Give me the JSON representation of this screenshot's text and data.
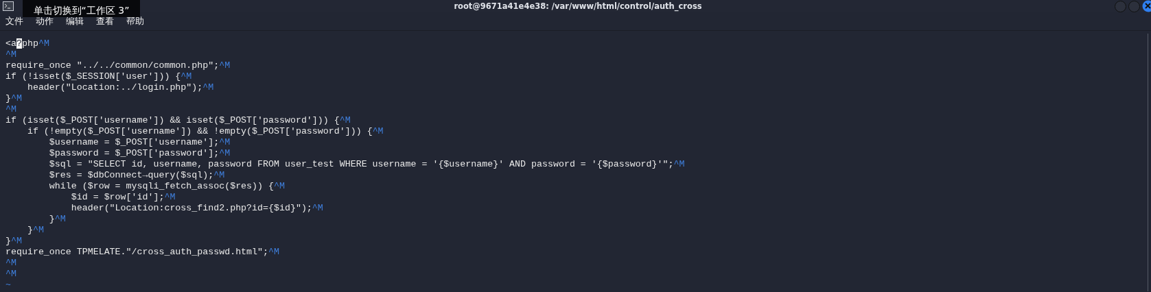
{
  "window": {
    "title": "root@9671a41e4e38: /var/www/html/control/auth_cross"
  },
  "menu": [
    {
      "label": "文件"
    },
    {
      "label": "动作"
    },
    {
      "label": "编辑"
    },
    {
      "label": "查看"
    },
    {
      "label": "帮助"
    }
  ],
  "tooltip": "单击切换到“工作区 3”",
  "editor": {
    "lines": [
      [
        {
          "kind": "code",
          "text": "<a"
        },
        {
          "kind": "cursor",
          "text": "?"
        },
        {
          "kind": "code",
          "text": "php"
        },
        {
          "kind": "ctrl",
          "text": "^M"
        }
      ],
      [
        {
          "kind": "ctrl",
          "text": "^M"
        }
      ],
      [
        {
          "kind": "code",
          "text": "require_once \"../../common/common.php\";"
        },
        {
          "kind": "ctrl",
          "text": "^M"
        }
      ],
      [
        {
          "kind": "code",
          "text": "if (!isset($_SESSION['user'])) {"
        },
        {
          "kind": "ctrl",
          "text": "^M"
        }
      ],
      [
        {
          "kind": "code",
          "text": "    header(\"Location:../login.php\");"
        },
        {
          "kind": "ctrl",
          "text": "^M"
        }
      ],
      [
        {
          "kind": "code",
          "text": "}"
        },
        {
          "kind": "ctrl",
          "text": "^M"
        }
      ],
      [
        {
          "kind": "ctrl",
          "text": "^M"
        }
      ],
      [
        {
          "kind": "code",
          "text": "if (isset($_POST['username']) && isset($_POST['password'])) {"
        },
        {
          "kind": "ctrl",
          "text": "^M"
        }
      ],
      [
        {
          "kind": "code",
          "text": "    if (!empty($_POST['username']) && !empty($_POST['password'])) {"
        },
        {
          "kind": "ctrl",
          "text": "^M"
        }
      ],
      [
        {
          "kind": "code",
          "text": "        $username = $_POST['username'];"
        },
        {
          "kind": "ctrl",
          "text": "^M"
        }
      ],
      [
        {
          "kind": "code",
          "text": "        $password = $_POST['password'];"
        },
        {
          "kind": "ctrl",
          "text": "^M"
        }
      ],
      [
        {
          "kind": "code",
          "text": "        $sql = \"SELECT id, username, password FROM user_test WHERE username = '{$username}' AND password = '{$password}'\";"
        },
        {
          "kind": "ctrl",
          "text": "^M"
        }
      ],
      [
        {
          "kind": "code",
          "text": "        $res = $dbConnect→query($sql);"
        },
        {
          "kind": "ctrl",
          "text": "^M"
        }
      ],
      [
        {
          "kind": "code",
          "text": "        while ($row = mysqli_fetch_assoc($res)) {"
        },
        {
          "kind": "ctrl",
          "text": "^M"
        }
      ],
      [
        {
          "kind": "code",
          "text": "            $id = $row['id'];"
        },
        {
          "kind": "ctrl",
          "text": "^M"
        }
      ],
      [
        {
          "kind": "code",
          "text": "            header(\"Location:cross_find2.php?id={$id}\");"
        },
        {
          "kind": "ctrl",
          "text": "^M"
        }
      ],
      [
        {
          "kind": "code",
          "text": "        }"
        },
        {
          "kind": "ctrl",
          "text": "^M"
        }
      ],
      [
        {
          "kind": "code",
          "text": "    }"
        },
        {
          "kind": "ctrl",
          "text": "^M"
        }
      ],
      [
        {
          "kind": "code",
          "text": "}"
        },
        {
          "kind": "ctrl",
          "text": "^M"
        }
      ],
      [
        {
          "kind": "code",
          "text": "require_once TPMELATE.\"/cross_auth_passwd.html\";"
        },
        {
          "kind": "ctrl",
          "text": "^M"
        }
      ],
      [
        {
          "kind": "ctrl",
          "text": "^M"
        }
      ],
      [
        {
          "kind": "ctrl",
          "text": "^M"
        }
      ],
      [
        {
          "kind": "tilde",
          "text": "~"
        }
      ]
    ]
  }
}
